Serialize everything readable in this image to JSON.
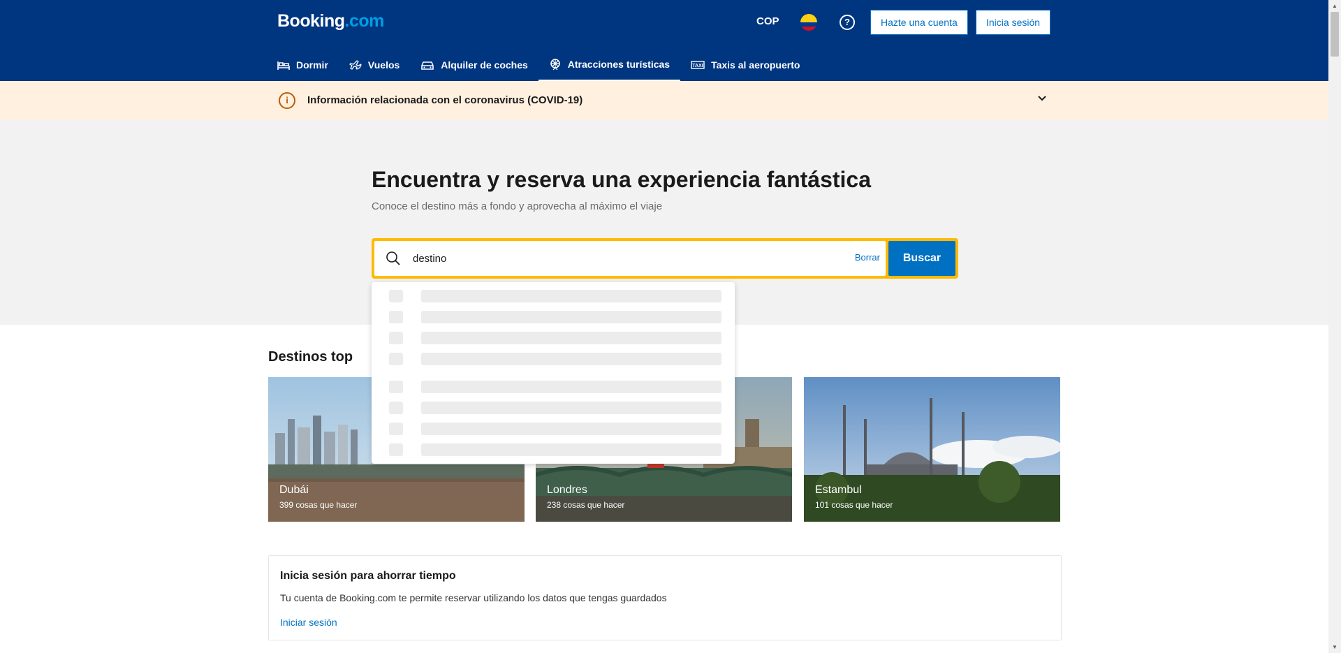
{
  "header": {
    "logo_main": "Booking",
    "logo_dot": ".com",
    "currency": "COP",
    "help_glyph": "?",
    "register_label": "Hazte una cuenta",
    "login_label": "Inicia sesión"
  },
  "nav": {
    "items": [
      {
        "label": "Dormir",
        "icon": "bed-icon"
      },
      {
        "label": "Vuelos",
        "icon": "plane-icon"
      },
      {
        "label": "Alquiler de coches",
        "icon": "car-icon"
      },
      {
        "label": "Atracciones turísticas",
        "icon": "attractions-icon",
        "active": true
      },
      {
        "label": "Taxis al aeropuerto",
        "icon": "taxi-icon"
      }
    ]
  },
  "covid": {
    "label": "Información relacionada con el coronavirus (COVID-19)"
  },
  "hero": {
    "title": "Encuentra y reserva una experiencia fantástica",
    "subtitle": "Conoce el destino más a fondo y aprovecha al máximo el viaje"
  },
  "search": {
    "value": "destino",
    "clear_label": "Borrar",
    "submit_label": "Buscar"
  },
  "destinations": {
    "title": "Destinos top",
    "cards": [
      {
        "name": "Dubái",
        "count": "399 cosas que hacer"
      },
      {
        "name": "Londres",
        "count": "238 cosas que hacer"
      },
      {
        "name": "Estambul",
        "count": "101 cosas que hacer"
      }
    ]
  },
  "login_box": {
    "title": "Inicia sesión para ahorrar tiempo",
    "text": "Tu cuenta de Booking.com te permite reservar utilizando los datos que tengas guardados",
    "link": "Iniciar sesión"
  },
  "colors": {
    "brand": "#003580",
    "accent": "#0071c2",
    "search_border": "#febb02",
    "covid_bg": "#fff0e0"
  }
}
